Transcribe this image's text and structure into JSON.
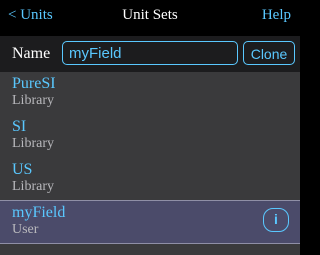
{
  "navbar": {
    "back_label": "< Units",
    "title": "Unit Sets",
    "help_label": "Help"
  },
  "name_row": {
    "label": "Name",
    "value": "myField",
    "clone_label": "Clone"
  },
  "unit_sets": [
    {
      "name": "PureSI",
      "type": "Library"
    },
    {
      "name": "SI",
      "type": "Library"
    },
    {
      "name": "US",
      "type": "Library"
    },
    {
      "name": "myField",
      "type": "User",
      "selected": true,
      "info_icon": "i"
    }
  ],
  "colors": {
    "accent": "#5ac8ff",
    "background": "#000000",
    "row_bg": "#3a3a3c",
    "selected_bg": "#4b4b6a"
  }
}
